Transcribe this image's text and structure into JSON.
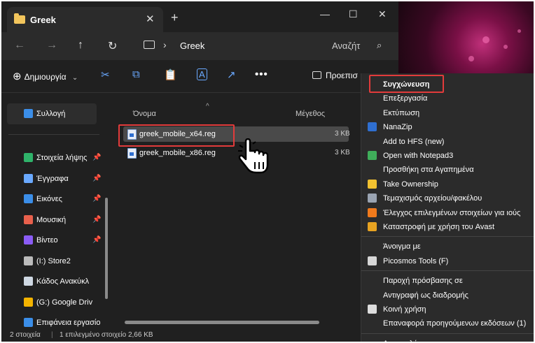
{
  "window": {
    "tab_title": "Greek",
    "tab_close": "✕",
    "new_tab": "+",
    "minimize": "—",
    "maximize": "☐",
    "close": "✕"
  },
  "nav": {
    "back": "←",
    "forward": "→",
    "up": "↑",
    "refresh": "↻",
    "breadcrumb": "Greek",
    "chevron": "›",
    "search_placeholder": "Αναζήτ",
    "search_icon": "⌕"
  },
  "toolbar": {
    "create_label": "Δημιουργία",
    "create_icon": "⊕",
    "dropdown": "⌄",
    "cut": "✂",
    "copy": "⧉",
    "paste": "📋",
    "rename": "A",
    "share": "↗",
    "more": "•••",
    "preview_label": "Προεπισ"
  },
  "sidebar": {
    "selected": "Συλλογή",
    "items": [
      {
        "label": "Στοιχεία λήψης",
        "pin": "📌",
        "color": "#2fb36a"
      },
      {
        "label": "Έγγραφα",
        "pin": "📌",
        "color": "#6aa9ff"
      },
      {
        "label": "Εικόνες",
        "pin": "📌",
        "color": "#3b8ee8"
      },
      {
        "label": "Μουσική",
        "pin": "📌",
        "color": "#e8604c"
      },
      {
        "label": "Βίντεο",
        "pin": "📌",
        "color": "#8b5cf6"
      },
      {
        "label": "(I:) Store2",
        "pin": "",
        "color": "#bbbbbb"
      },
      {
        "label": "Κάδος Ανακύκλ",
        "pin": "",
        "color": "#cfd8e3"
      },
      {
        "label": "(G:) Google Driv",
        "pin": "",
        "color": "#f4b400"
      },
      {
        "label": "Επιφάνεια εργασίο",
        "pin": "",
        "color": "#3b8ee8"
      }
    ]
  },
  "content": {
    "col_name": "Όνομα",
    "col_size": "Μέγεθος",
    "sort_arrow": "^",
    "files": [
      {
        "name": "greek_mobile_x64.reg",
        "size": "3 KB",
        "selected": true
      },
      {
        "name": "greek_mobile_x86.reg",
        "size": "3 KB",
        "selected": false
      }
    ]
  },
  "status": {
    "count": "2 στοιχεία",
    "selection": "1 επιλεγμένο στοιχείο 2,66 KB",
    "sep": "|"
  },
  "context_menu": {
    "groups": [
      [
        {
          "label": "Συγχώνευση",
          "bold": true,
          "icon": "",
          "color": ""
        },
        {
          "label": "Επεξεργασία",
          "bold": false,
          "icon": "",
          "color": ""
        },
        {
          "label": "Εκτύπωση",
          "bold": false,
          "icon": "",
          "color": ""
        },
        {
          "label": "NanaZip",
          "bold": false,
          "icon": "nanazip-icon",
          "color": "#2f6fd0"
        },
        {
          "label": "Add to HFS (new)",
          "bold": false,
          "icon": "",
          "color": ""
        },
        {
          "label": "Open with Notepad3",
          "bold": false,
          "icon": "notepad3-icon",
          "color": "#3fae5a"
        },
        {
          "label": "Προσθήκη στα Αγαπημένα",
          "bold": false,
          "icon": "",
          "color": ""
        },
        {
          "label": "Take Ownership",
          "bold": false,
          "icon": "shield-icon",
          "color": "#f2c230"
        },
        {
          "label": "Τεμαχισμός αρχείου/φακέλου",
          "bold": false,
          "icon": "shredder-icon",
          "color": "#9aa4b2"
        },
        {
          "label": "Έλεγχος επιλεγμένων στοιχείων για ιούς",
          "bold": false,
          "icon": "avast-icon",
          "color": "#f07a1c"
        },
        {
          "label": "Καταστροφή με χρήση του Avast",
          "bold": false,
          "icon": "avast-shredder-icon",
          "color": "#e8a321"
        }
      ],
      [
        {
          "label": "Άνοιγμα με",
          "bold": false,
          "icon": "",
          "color": ""
        },
        {
          "label": "Picosmos Tools (F)",
          "bold": false,
          "icon": "picosmos-icon",
          "color": "#d7d7d7"
        }
      ],
      [
        {
          "label": "Παροχή πρόσβασης σε",
          "bold": false,
          "icon": "",
          "color": ""
        },
        {
          "label": "Αντιγραφή ως διαδρομής",
          "bold": false,
          "icon": "",
          "color": ""
        },
        {
          "label": "Κοινή χρήση",
          "bold": false,
          "icon": "share-icon",
          "color": "#dddddd"
        },
        {
          "label": "Επαναφορά προηγούμενων εκδόσεων (1)",
          "bold": false,
          "icon": "",
          "color": ""
        }
      ],
      [
        {
          "label": "Αποστολή προς",
          "bold": false,
          "icon": "",
          "color": ""
        }
      ]
    ]
  },
  "colors": {
    "accent": "#6aa9ff",
    "highlight_box": "#e23b3b"
  }
}
